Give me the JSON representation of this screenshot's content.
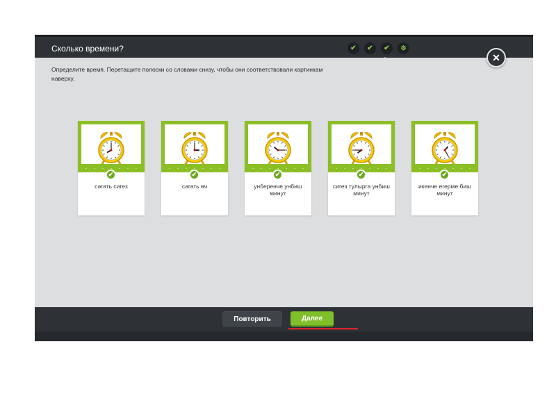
{
  "dialog": {
    "title": "Сколько времени?",
    "instruction": "Определите время. Перетащите полоски со словами снизу, чтобы они соответствовали картинкам наверху.",
    "close_icon": "close-icon",
    "progress": [
      "check-icon",
      "check-icon",
      "check-icon",
      "gear-icon"
    ]
  },
  "cards": [
    {
      "label": "сәгать сигез",
      "hour": 8,
      "minute": 0
    },
    {
      "label": "сәгать өч",
      "hour": 3,
      "minute": 0
    },
    {
      "label": "унберенче унбиш минут",
      "hour": 10,
      "minute": 15
    },
    {
      "label": "сигез тулырга унбиш минут",
      "hour": 7,
      "minute": 45
    },
    {
      "label": "икенче егерме биш минут",
      "hour": 1,
      "minute": 25
    }
  ],
  "footer": {
    "repeat_label": "Повторить",
    "next_label": "Далее"
  },
  "colors": {
    "accent_green": "#7fbf2a",
    "header_dark": "#2e3237",
    "highlight_red": "#e0252a"
  }
}
